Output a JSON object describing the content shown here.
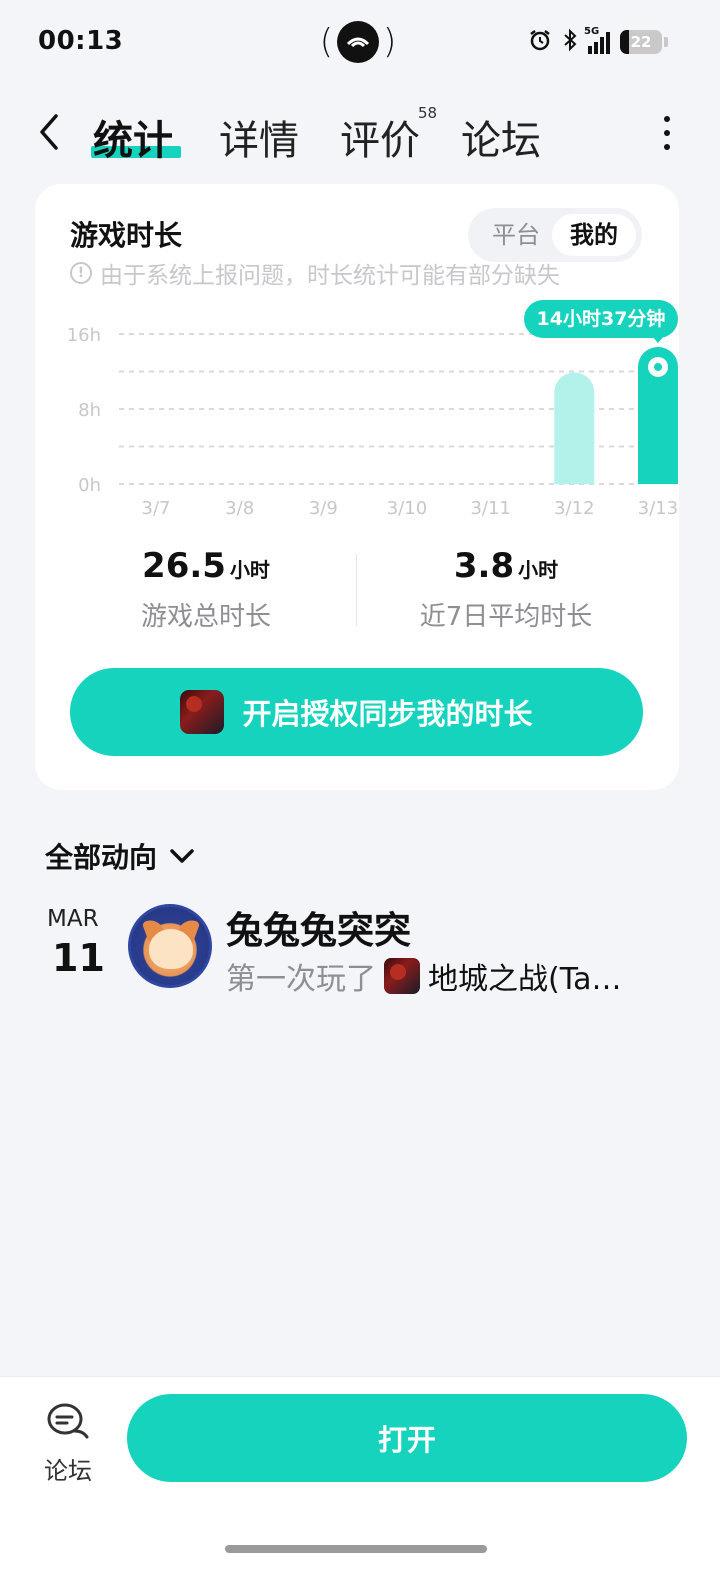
{
  "status_bar": {
    "time": "00:13",
    "network": "5G",
    "battery": "22",
    "icons": [
      "alarm-icon",
      "bluetooth-icon",
      "signal-icon",
      "battery-icon"
    ]
  },
  "nav": {
    "tabs": [
      {
        "label": "统计",
        "active": true
      },
      {
        "label": "详情",
        "active": false
      },
      {
        "label": "评价",
        "active": false,
        "badge": "58"
      },
      {
        "label": "论坛",
        "active": false
      }
    ]
  },
  "playtime": {
    "title": "游戏时长",
    "notice": "由于系统上报问题，时长统计可能有部分缺失",
    "toggle": {
      "platform": "平台",
      "mine": "我的",
      "selected": "我的"
    },
    "tooltip": "14小时37分钟",
    "total_value": "26.5",
    "total_unit": "小时",
    "total_label": "游戏总时长",
    "avg_value": "3.8",
    "avg_unit": "小时",
    "avg_label": "近7日平均时长",
    "sync_button": "开启授权同步我的时长"
  },
  "chart_data": {
    "type": "bar",
    "categories": [
      "3/7",
      "3/8",
      "3/9",
      "3/10",
      "3/11",
      "3/12",
      "3/13"
    ],
    "values": [
      0,
      0,
      0,
      0,
      0,
      11.9,
      14.62
    ],
    "highlighted_index": 6,
    "ylim": [
      0,
      16
    ],
    "yticks": [
      0,
      8,
      16
    ],
    "ytick_labels": [
      "0h",
      "8h",
      "16h"
    ],
    "grid": true,
    "colors": {
      "bar": "#b3f2ea",
      "highlight": "#16d3bd",
      "grid": "#d9d9de",
      "axis_text": "#c7c7cc"
    }
  },
  "activity": {
    "filter_label": "全部动向",
    "items": [
      {
        "month": "MAR",
        "day": "11",
        "username": "兔兔兔突突",
        "action": "第一次玩了",
        "game": "地城之战(Ta…"
      }
    ]
  },
  "bottom_bar": {
    "forum_label": "论坛",
    "open_button": "打开"
  },
  "colors": {
    "accent": "#16d3bd",
    "background": "#f4f5f8",
    "muted": "#8e8e93"
  }
}
